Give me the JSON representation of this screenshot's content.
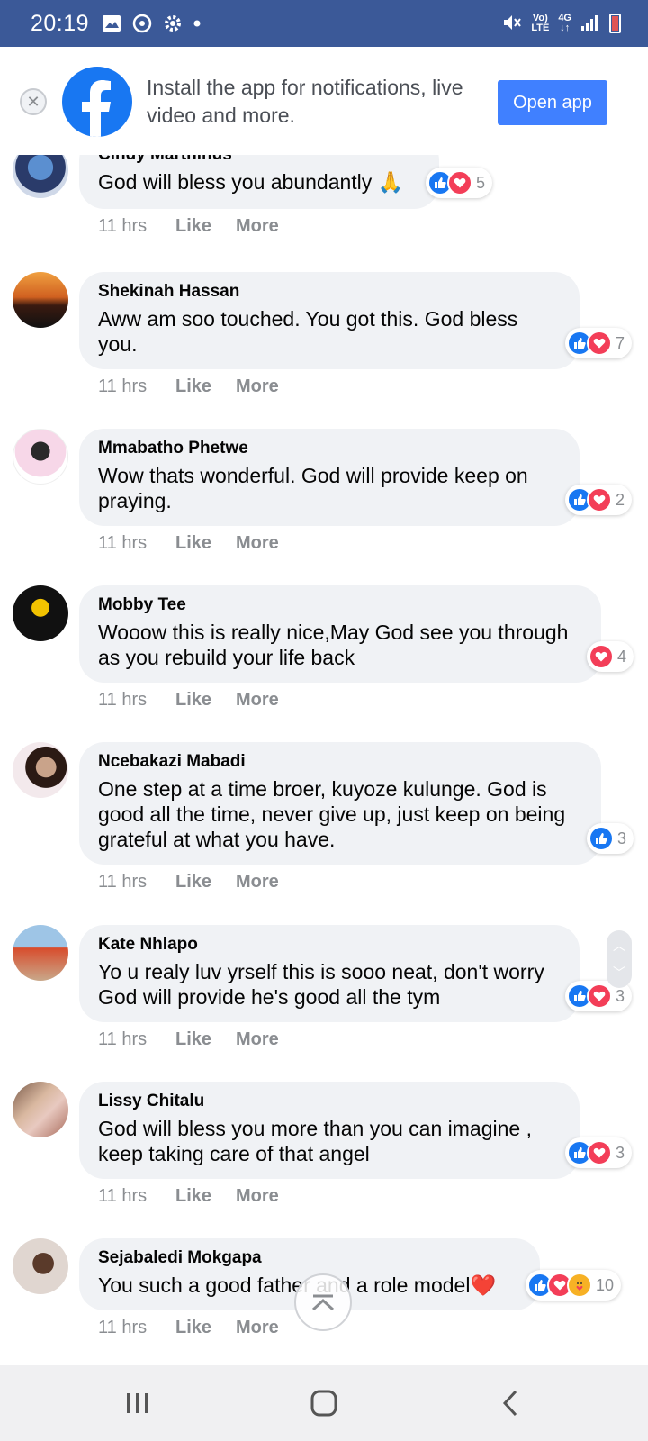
{
  "status_bar": {
    "time": "20:19",
    "network_top": "Vo)",
    "network_bottom": "LTE",
    "gen": "4G",
    "left_icons": [
      "image-icon",
      "sync-icon",
      "gear-icon",
      "dot-icon"
    ],
    "right_icons": [
      "mute-icon",
      "signal-icon",
      "battery-icon"
    ],
    "bar_color": "#3b5998"
  },
  "banner": {
    "text": "Install the app for notifications, live video and more.",
    "button_label": "Open app",
    "accent": "#1877f2"
  },
  "comments": [
    {
      "author": "Cindy Marthinus",
      "text": "God will bless you abundantly 🙏",
      "time": "11 hrs",
      "like": "Like",
      "more": "More",
      "reactions": [
        "like",
        "love"
      ],
      "count": "5"
    },
    {
      "author": "Shekinah Hassan",
      "text": "Aww am soo touched. You got this. God bless you.",
      "time": "11 hrs",
      "like": "Like",
      "more": "More",
      "reactions": [
        "like",
        "love"
      ],
      "count": "7"
    },
    {
      "author": "Mmabatho Phetwe",
      "text": "Wow thats wonderful. God will provide keep on praying.",
      "time": "11 hrs",
      "like": "Like",
      "more": "More",
      "reactions": [
        "like",
        "love"
      ],
      "count": "2"
    },
    {
      "author": "Mobby Tee",
      "text": "Wooow this is really nice,May God see you through as you rebuild your life back",
      "time": "11 hrs",
      "like": "Like",
      "more": "More",
      "reactions": [
        "love"
      ],
      "count": "4"
    },
    {
      "author": "Ncebakazi Mabadi",
      "text": "One step at a time broer, kuyoze kulunge. God is good all the time, never give up, just keep on being grateful at what you have.",
      "time": "11 hrs",
      "like": "Like",
      "more": "More",
      "reactions": [
        "like"
      ],
      "count": "3"
    },
    {
      "author": "Kate Nhlapo",
      "text": "Yo u realy luv yrself this is sooo neat, don't worry God will provide he's good all the tym",
      "time": "11 hrs",
      "like": "Like",
      "more": "More",
      "reactions": [
        "like",
        "love"
      ],
      "count": "3"
    },
    {
      "author": "Lissy Chitalu",
      "text": "God will bless you more than you can imagine , keep taking care of that angel",
      "time": "11 hrs",
      "like": "Like",
      "more": "More",
      "reactions": [
        "like",
        "love"
      ],
      "count": "3"
    },
    {
      "author": "Sejabaledi Mokgapa",
      "text": "You such a good father and a role model❤️",
      "time": "11 hrs",
      "like": "Like",
      "more": "More",
      "reactions": [
        "like",
        "love",
        "care"
      ],
      "count": "10"
    }
  ],
  "navbar": {
    "icons": [
      "recent-apps-icon",
      "home-icon",
      "back-icon"
    ]
  }
}
